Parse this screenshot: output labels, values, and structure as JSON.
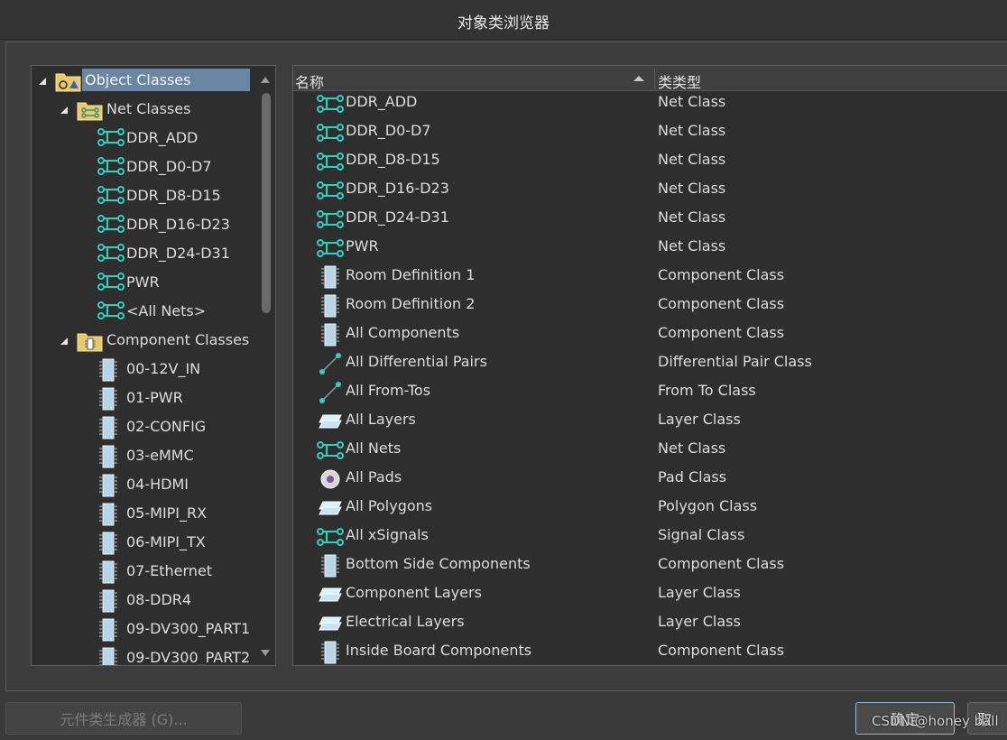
{
  "window": {
    "title": "对象类浏览器"
  },
  "tree": {
    "root": {
      "label": "Object Classes",
      "icon": "object-classes-folder-icon",
      "expanded": true,
      "selected": true
    },
    "groups": [
      {
        "label": "Net Classes",
        "icon": "net-classes-folder-icon",
        "expanded": true,
        "items": [
          {
            "label": "DDR_ADD",
            "icon": "net-class-icon"
          },
          {
            "label": "DDR_D0-D7",
            "icon": "net-class-icon"
          },
          {
            "label": "DDR_D8-D15",
            "icon": "net-class-icon"
          },
          {
            "label": "DDR_D16-D23",
            "icon": "net-class-icon"
          },
          {
            "label": "DDR_D24-D31",
            "icon": "net-class-icon"
          },
          {
            "label": "PWR",
            "icon": "net-class-icon"
          },
          {
            "label": "<All Nets>",
            "icon": "net-class-icon"
          }
        ]
      },
      {
        "label": "Component Classes",
        "icon": "component-classes-folder-icon",
        "expanded": true,
        "items": [
          {
            "label": "00-12V_IN",
            "icon": "component-class-icon"
          },
          {
            "label": "01-PWR",
            "icon": "component-class-icon"
          },
          {
            "label": "02-CONFIG",
            "icon": "component-class-icon"
          },
          {
            "label": "03-eMMC",
            "icon": "component-class-icon"
          },
          {
            "label": "04-HDMI",
            "icon": "component-class-icon"
          },
          {
            "label": "05-MIPI_RX",
            "icon": "component-class-icon"
          },
          {
            "label": "06-MIPI_TX",
            "icon": "component-class-icon"
          },
          {
            "label": "07-Ethernet",
            "icon": "component-class-icon"
          },
          {
            "label": "08-DDR4",
            "icon": "component-class-icon"
          },
          {
            "label": "09-DV300_PART1",
            "icon": "component-class-icon"
          },
          {
            "label": "09-DV300_PART2",
            "icon": "component-class-icon"
          }
        ]
      }
    ]
  },
  "list": {
    "columns": {
      "name": "名称",
      "type": "类类型",
      "sort": "descending"
    },
    "rows": [
      {
        "name": "DDR_ADD",
        "type": "Net Class",
        "icon": "net-class-icon"
      },
      {
        "name": "DDR_D0-D7",
        "type": "Net Class",
        "icon": "net-class-icon"
      },
      {
        "name": "DDR_D8-D15",
        "type": "Net Class",
        "icon": "net-class-icon"
      },
      {
        "name": "DDR_D16-D23",
        "type": "Net Class",
        "icon": "net-class-icon"
      },
      {
        "name": "DDR_D24-D31",
        "type": "Net Class",
        "icon": "net-class-icon"
      },
      {
        "name": "PWR",
        "type": "Net Class",
        "icon": "net-class-icon"
      },
      {
        "name": "Room Definition 1",
        "type": "Component Class",
        "icon": "component-class-icon"
      },
      {
        "name": "Room Definition 2",
        "type": "Component Class",
        "icon": "component-class-icon"
      },
      {
        "name": "All Components",
        "type": "Component Class",
        "icon": "component-class-icon"
      },
      {
        "name": "All Differential Pairs",
        "type": "Differential Pair Class",
        "icon": "differential-pair-icon"
      },
      {
        "name": "All From-Tos",
        "type": "From To Class",
        "icon": "from-to-icon"
      },
      {
        "name": "All Layers",
        "type": "Layer Class",
        "icon": "layer-class-icon"
      },
      {
        "name": "All Nets",
        "type": "Net Class",
        "icon": "net-class-icon"
      },
      {
        "name": "All Pads",
        "type": "Pad Class",
        "icon": "pad-class-icon"
      },
      {
        "name": "All Polygons",
        "type": "Polygon Class",
        "icon": "layer-class-icon"
      },
      {
        "name": "All xSignals",
        "type": "Signal Class",
        "icon": "net-class-icon"
      },
      {
        "name": "Bottom Side Components",
        "type": "Component Class",
        "icon": "component-class-icon"
      },
      {
        "name": "Component Layers",
        "type": "Layer Class",
        "icon": "layer-class-icon"
      },
      {
        "name": "Electrical Layers",
        "type": "Layer Class",
        "icon": "layer-class-icon"
      },
      {
        "name": "Inside Board Components",
        "type": "Component Class",
        "icon": "component-class-icon"
      }
    ]
  },
  "footer": {
    "generator_label": "元件类生成器 (G)...",
    "ok_label": "确定",
    "cancel_label": "取"
  },
  "watermark": "CSDN @honey ball",
  "colors": {
    "selection": "#6b86a3",
    "icon_teal": "#2fd0c0",
    "panel_bg": "#2e2e2e"
  }
}
